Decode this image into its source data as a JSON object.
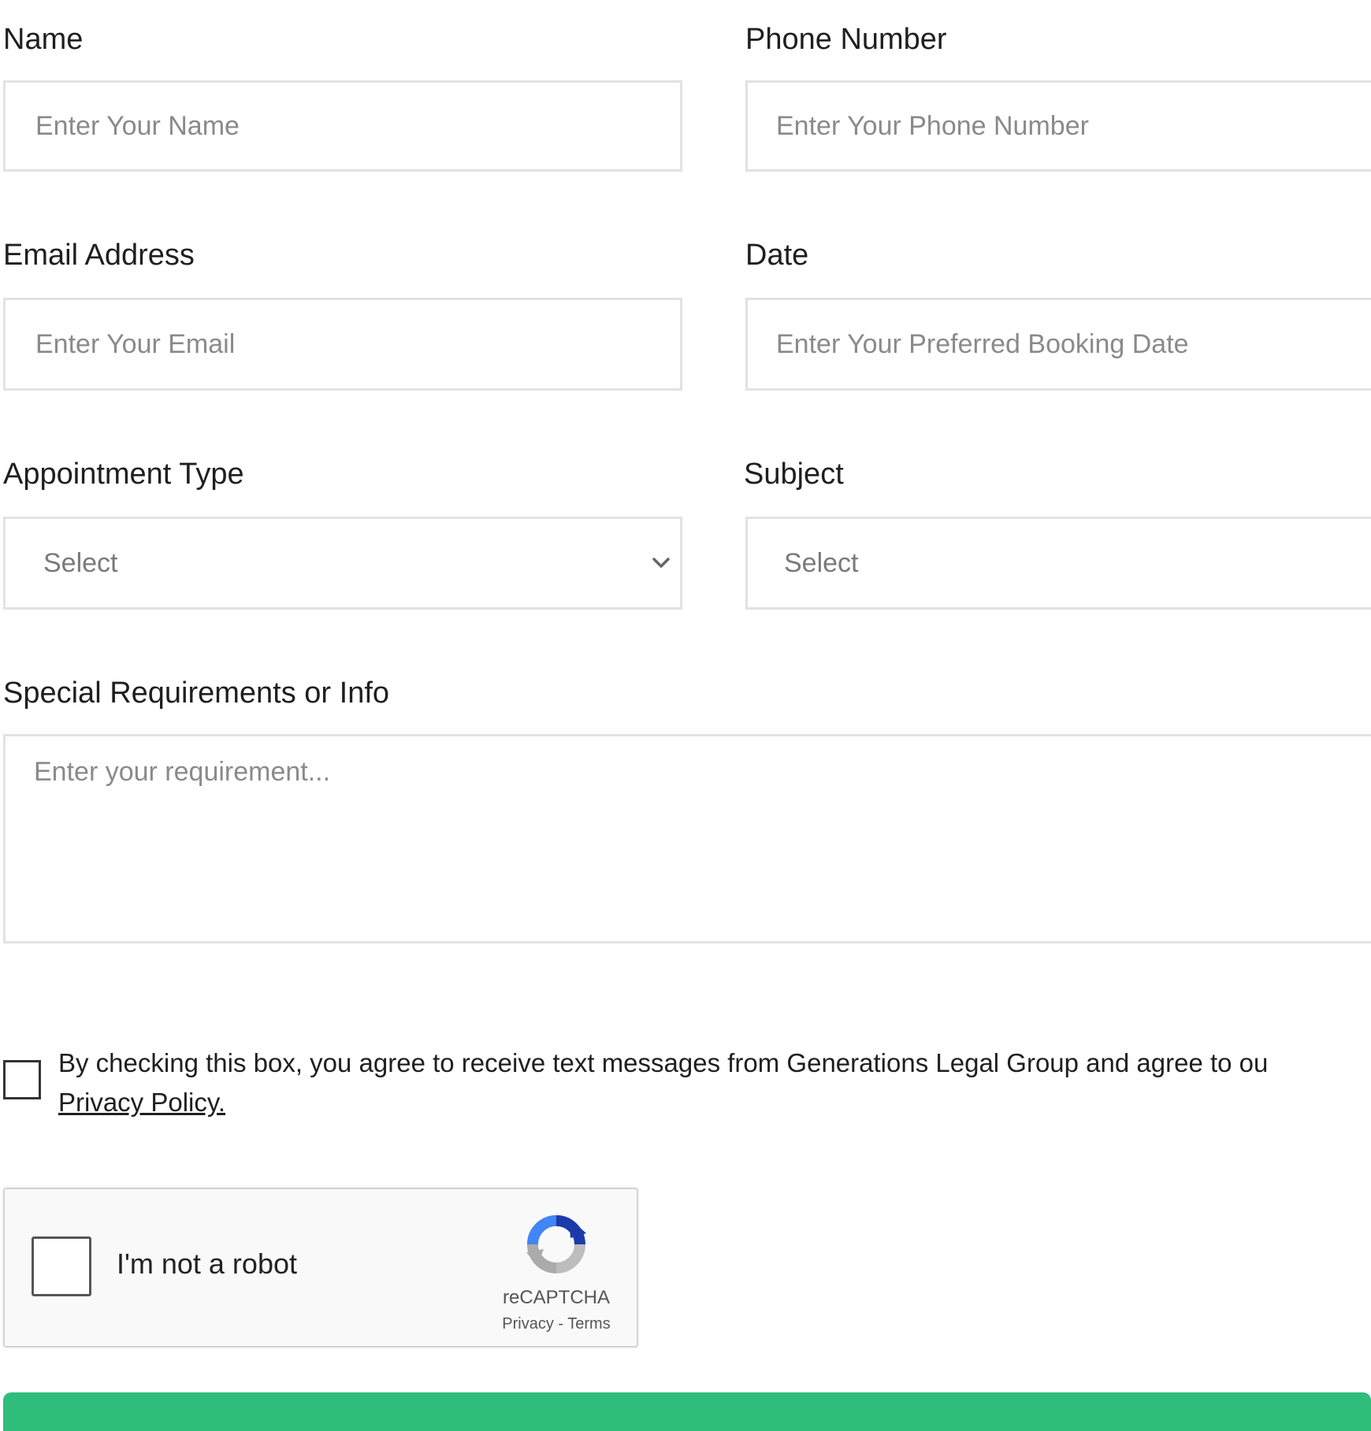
{
  "form": {
    "name": {
      "label": "Name",
      "placeholder": "Enter Your Name"
    },
    "phone": {
      "label": "Phone Number",
      "placeholder": "Enter Your Phone Number"
    },
    "email": {
      "label": "Email Address",
      "placeholder": "Enter Your Email"
    },
    "date": {
      "label": "Date",
      "placeholder": "Enter Your Preferred Booking Date"
    },
    "appointment_type": {
      "label": "Appointment Type",
      "selected": "Select"
    },
    "subject": {
      "label": "Subject",
      "selected": "Select"
    },
    "requirements": {
      "label": "Special Requirements or Info",
      "placeholder": "Enter your requirement..."
    },
    "consent": {
      "text": "By checking this box, you agree to receive text messages from Generations Legal Group and agree to ou",
      "link": "Privacy Policy."
    },
    "recaptcha": {
      "label": "I'm not a robot",
      "brand": "reCAPTCHA",
      "links": "Privacy - Terms"
    }
  },
  "colors": {
    "border": "#e2e2e2",
    "placeholder": "#8a8a8a",
    "accent": "#2fbd7c"
  },
  "icons": {
    "select_chevron": "chevron-down-icon",
    "recaptcha_logo": "recaptcha-logo-icon"
  }
}
